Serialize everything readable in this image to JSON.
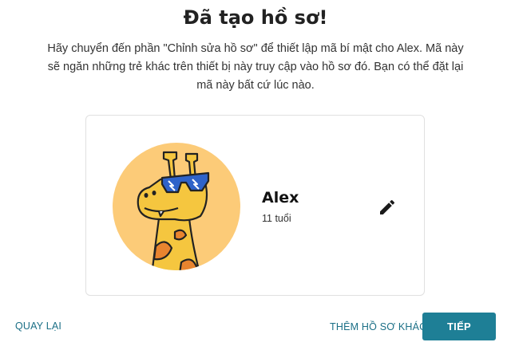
{
  "header": {
    "title": "Đã tạo hồ sơ!",
    "description": "Hãy chuyển đến phần \"Chỉnh sửa hồ sơ\" để thiết lập mã bí mật cho Alex. Mã này sẽ ngăn những trẻ khác trên thiết bị này truy cập vào hồ sơ đó. Bạn có thể đặt lại mã này bất cứ lúc nào."
  },
  "profile": {
    "name": "Alex",
    "age": "11 tuổi",
    "avatar_icon": "giraffe-avatar-icon",
    "edit_icon": "pencil-icon"
  },
  "footer": {
    "back_label": "QUAY LẠI",
    "add_profile_label": "THÊM HỒ SƠ KHÁC",
    "next_label": "TIẾP"
  },
  "colors": {
    "accent": "#1e7f96",
    "link": "#1b6f86",
    "avatar_bg": "#fccb78",
    "giraffe": "#f5c63f",
    "giraffe_spots": "#e8842f",
    "sunglasses": "#2f63c9"
  }
}
